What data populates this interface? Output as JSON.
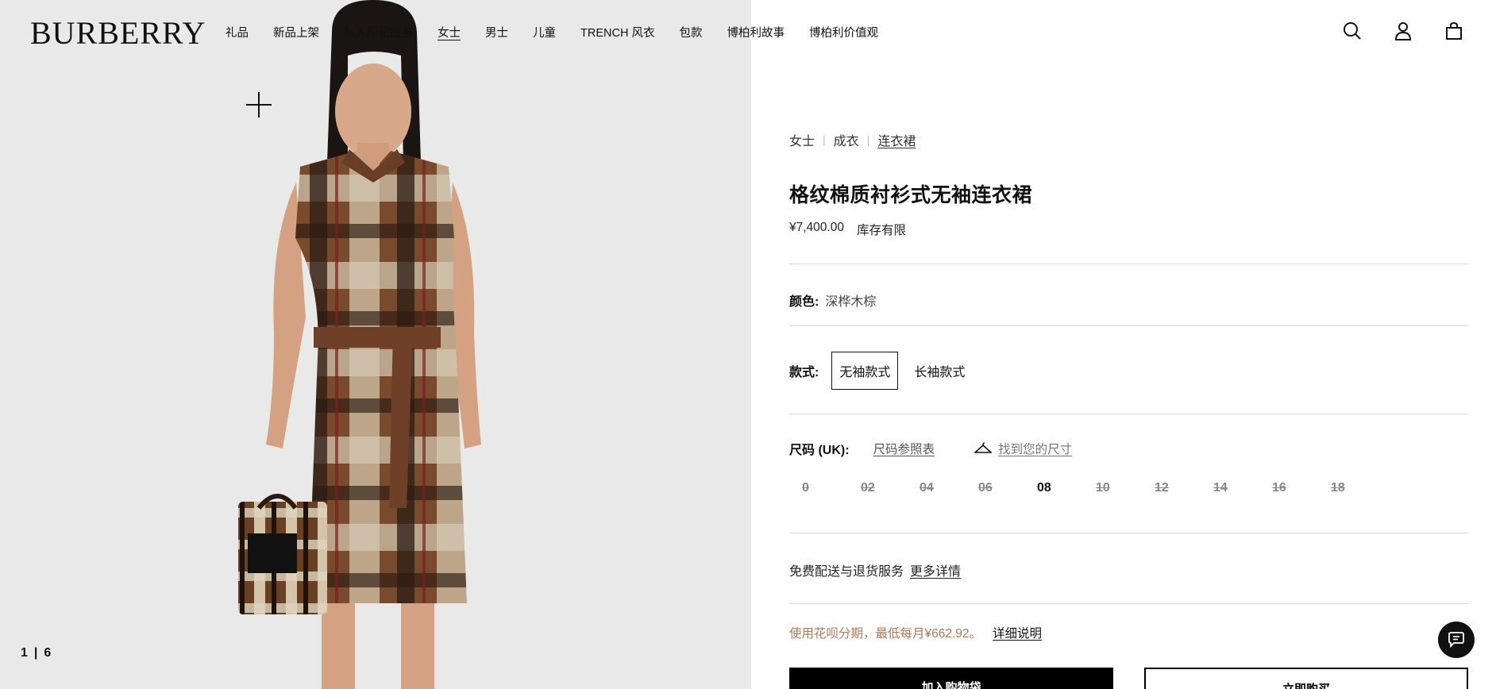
{
  "brand": {
    "logo": "BURBERRY"
  },
  "nav": {
    "items": [
      "礼品",
      "新品上架",
      "私人印记服务",
      "女士",
      "男士",
      "儿童",
      "TRENCH 风衣",
      "包款",
      "博柏利故事",
      "博柏利价值观"
    ],
    "active_index": 3
  },
  "header_icons": [
    "search-icon",
    "account-icon",
    "bag-icon"
  ],
  "gallery": {
    "current": "1",
    "separator": "|",
    "total": "6"
  },
  "product": {
    "breadcrumb": [
      "女士",
      "成衣",
      "连衣裙"
    ],
    "title": "格纹棉质衬衫式无袖连衣裙",
    "price": "¥7,400.00",
    "stock": "库存有限",
    "color_label": "颜色:",
    "color_value": "深桦木棕",
    "style_label": "款式:",
    "style_options": [
      "无袖款式",
      "长袖款式"
    ],
    "style_selected": 0,
    "size_label": "尺码 (UK):",
    "size_chart_link": "尺码参照表",
    "find_size_link": "找到您的尺寸",
    "sizes": [
      {
        "label": "0",
        "available": false
      },
      {
        "label": "02",
        "available": false
      },
      {
        "label": "04",
        "available": false
      },
      {
        "label": "06",
        "available": false
      },
      {
        "label": "08",
        "available": true
      },
      {
        "label": "10",
        "available": false
      },
      {
        "label": "12",
        "available": false
      },
      {
        "label": "14",
        "available": false
      },
      {
        "label": "16",
        "available": false
      },
      {
        "label": "18",
        "available": false
      }
    ],
    "shipping_text": "免费配送与退货服务",
    "shipping_more": "更多详情",
    "installment_text": "使用花呗分期，最低每月¥662.92。",
    "installment_more": "详细说明",
    "add_to_bag": "加入购物袋",
    "buy_now": "立即购买"
  },
  "colors": {
    "accent": "#000000",
    "installment": "#a87a5a",
    "divider": "#d8d8d8"
  }
}
